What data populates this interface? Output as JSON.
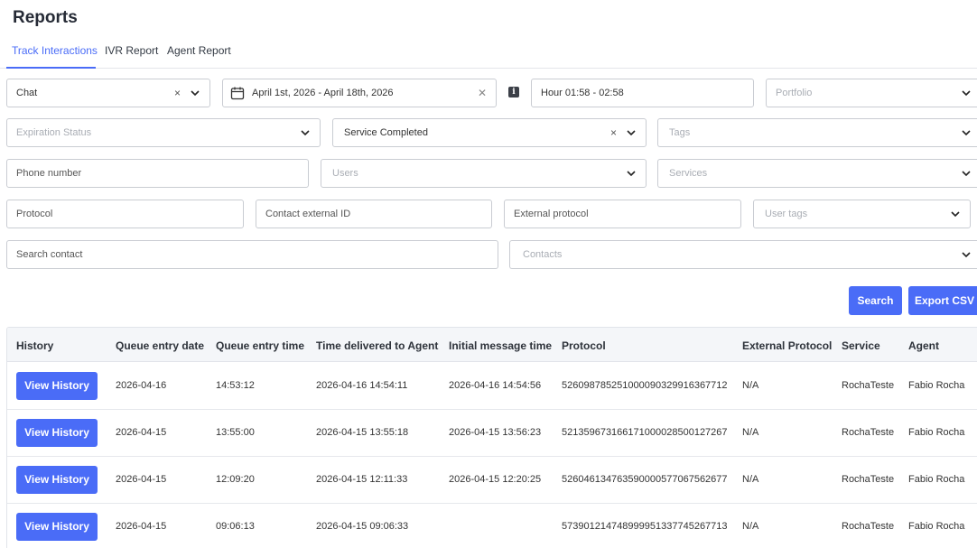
{
  "page": {
    "title": "Reports"
  },
  "tabs": [
    {
      "label": "Track Interactions",
      "active": true
    },
    {
      "label": "IVR Report",
      "active": false
    },
    {
      "label": "Agent Report",
      "active": false
    }
  ],
  "filters": {
    "channel": {
      "value": "Chat",
      "clear": "×"
    },
    "date_range": {
      "value": "April 1st, 2026 - April 18th, 2026",
      "clear": "✕"
    },
    "info": "i",
    "hour": {
      "value": "Hour 01:58 - 02:58"
    },
    "portfolio": {
      "placeholder": "Portfolio"
    },
    "expiration_status": {
      "placeholder": "Expiration Status"
    },
    "service_status": {
      "value": "Service Completed",
      "clear": "×"
    },
    "tags": {
      "placeholder": "Tags"
    },
    "phone_number": {
      "placeholder": "Phone number"
    },
    "users": {
      "placeholder": "Users"
    },
    "services": {
      "placeholder": "Services"
    },
    "protocol": {
      "placeholder": "Protocol"
    },
    "contact_external_id": {
      "placeholder": "Contact external ID"
    },
    "external_protocol": {
      "placeholder": "External protocol"
    },
    "user_tags": {
      "placeholder": "User tags"
    },
    "search_contact": {
      "placeholder": "Search contact"
    },
    "contacts": {
      "placeholder": "Contacts"
    }
  },
  "actions": {
    "search": "Search",
    "export_csv": "Export CSV"
  },
  "table": {
    "columns": [
      "History",
      "Queue entry date",
      "Queue entry time",
      "Time delivered to Agent",
      "Initial message time",
      "Protocol",
      "External Protocol",
      "Service",
      "Agent"
    ],
    "view_label": "View History",
    "rows": [
      {
        "queue_date": "2026-04-16",
        "queue_time": "14:53:12",
        "delivered": "2026-04-16 14:54:11",
        "initial": "2026-04-16 14:54:56",
        "protocol": "52609878525100009032991636771​2",
        "ext_protocol": "N/A",
        "service": "RochaTeste",
        "agent": "Fabio Rocha"
      },
      {
        "queue_date": "2026-04-15",
        "queue_time": "13:55:00",
        "delivered": "2026-04-15 13:55:18",
        "initial": "2026-04-15 13:56:23",
        "protocol": "521359673166171000028500127267",
        "ext_protocol": "N/A",
        "service": "RochaTeste",
        "agent": "Fabio Rocha"
      },
      {
        "queue_date": "2026-04-15",
        "queue_time": "12:09:20",
        "delivered": "2026-04-15 12:11:33",
        "initial": "2026-04-15 12:20:25",
        "protocol": "526046134763590000577067562677",
        "ext_protocol": "N/A",
        "service": "RochaTeste",
        "agent": "Fabio Rocha"
      },
      {
        "queue_date": "2026-04-15",
        "queue_time": "09:06:13",
        "delivered": "2026-04-15 09:06:33",
        "initial": "",
        "protocol": "573901214748999951337745267713",
        "ext_protocol": "N/A",
        "service": "RochaTeste",
        "agent": "Fabio Rocha"
      }
    ]
  }
}
